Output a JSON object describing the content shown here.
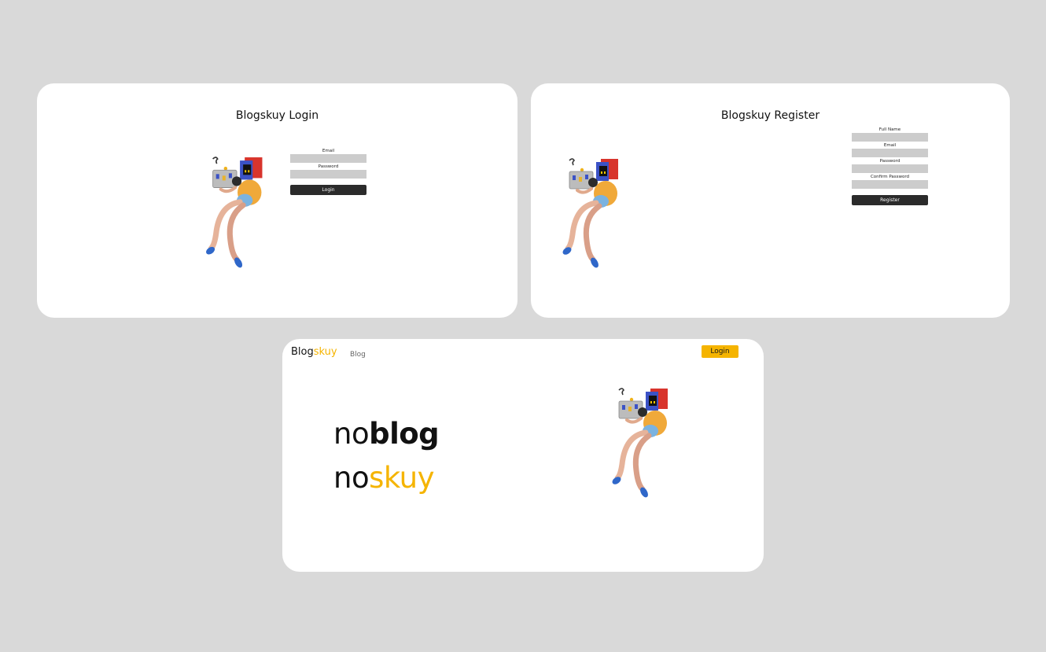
{
  "colors": {
    "background": "#d9d9d9",
    "card": "#ffffff",
    "accent": "#f5b400",
    "dark_button": "#2b2b2b",
    "input_fill": "#cccccc"
  },
  "login_page": {
    "title": "Blogskuy Login",
    "illustration": "person-with-laptop-illustration",
    "fields": [
      {
        "label": "Email",
        "value": ""
      },
      {
        "label": "Password",
        "value": ""
      }
    ],
    "submit_label": "Login"
  },
  "register_page": {
    "title": "Blogskuy Register",
    "illustration": "person-with-laptop-illustration",
    "fields": [
      {
        "label": "Full Name",
        "value": ""
      },
      {
        "label": "Email",
        "value": ""
      },
      {
        "label": "Password",
        "value": ""
      },
      {
        "label": "Confirm Password",
        "value": ""
      }
    ],
    "submit_label": "Register"
  },
  "home_page": {
    "brand": {
      "prefix": "Blog",
      "suffix": "skuy"
    },
    "nav_link": "Blog",
    "login_button": "Login",
    "hero": {
      "line1_prefix": "no",
      "line1_bold": "blog",
      "line2_prefix": "no",
      "line2_accent": "skuy"
    },
    "illustration": "person-with-laptop-illustration"
  }
}
